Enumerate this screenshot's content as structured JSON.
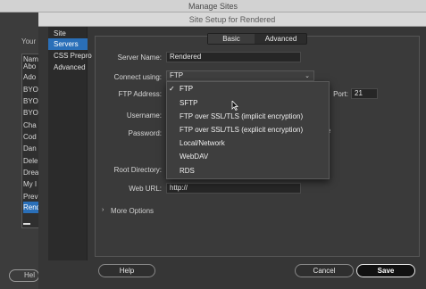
{
  "outer_window": {
    "title": "Manage Sites",
    "your_label": "Your",
    "list_items": [
      "Nam",
      "Abo",
      "Ado",
      "BYO",
      "BYO",
      "BYO",
      "Cha",
      "Cod",
      "Dan",
      "Dele",
      "Drea",
      "My I",
      "Prev",
      "Valid",
      "Rend"
    ],
    "selected_index": 14,
    "help_button": "Hel"
  },
  "dialog": {
    "title": "Site Setup for Rendered",
    "nav": [
      "Site",
      "Servers",
      "CSS Prepro",
      "Advanced"
    ],
    "nav_active_index": 1,
    "tabs": {
      "basic": "Basic",
      "advanced": "Advanced"
    },
    "form": {
      "server_name_label": "Server Name:",
      "server_name_value": "Rendered",
      "connect_using_label": "Connect using:",
      "connect_using_value": "FTP",
      "ftp_address_label": "FTP Address:",
      "port_label": "Port:",
      "port_value": "21",
      "username_label": "Username:",
      "password_label": "Password:",
      "root_directory_label": "Root Directory:",
      "web_url_label": "Web URL:",
      "web_url_value": "http://",
      "trailing_letter": "e"
    },
    "dropdown": {
      "options": [
        "FTP",
        "SFTP",
        "FTP over SSL/TLS (implicit encryption)",
        "FTP over SSL/TLS (explicit encryption)",
        "Local/Network",
        "WebDAV",
        "RDS"
      ],
      "checked_index": 0,
      "check_mark": "✓"
    },
    "more_options": "More Options",
    "buttons": {
      "help": "Help",
      "cancel": "Cancel",
      "save": "Save"
    },
    "colors": {
      "selection": "#2a6fb8",
      "dropdown_highlight": "#3f7fd6"
    }
  }
}
